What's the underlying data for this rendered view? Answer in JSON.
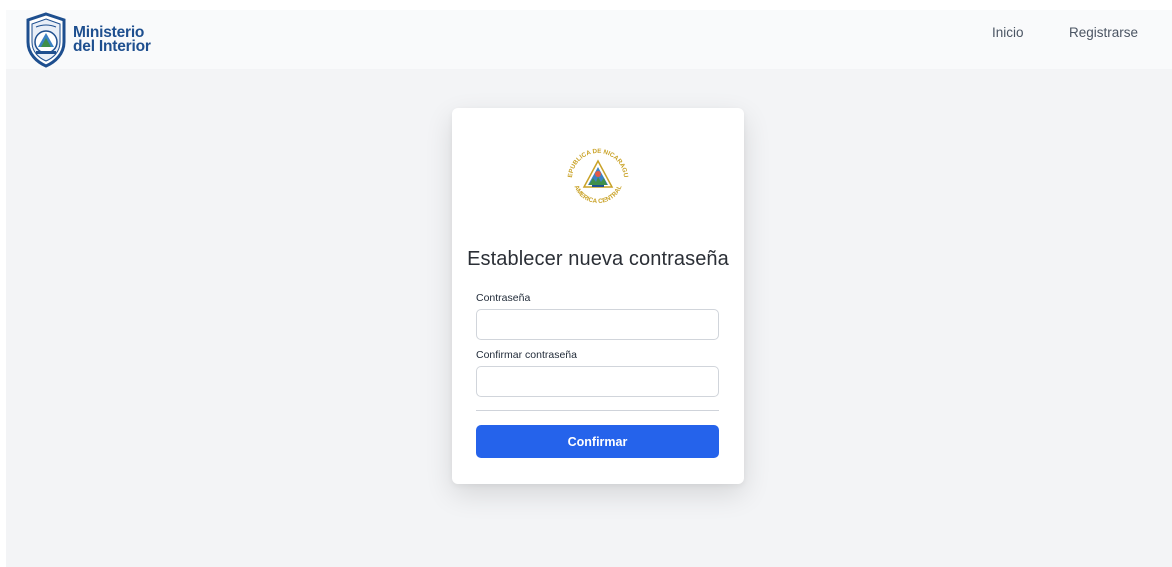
{
  "header": {
    "brand_line1": "Ministerio",
    "brand_line2": "del Interior",
    "nav": [
      {
        "label": "Inicio"
      },
      {
        "label": "Registrarse"
      }
    ]
  },
  "card": {
    "seal_top_text": "REPUBLICA DE NICARAGUA",
    "seal_bottom_text": "AMERICA CENTRAL",
    "title": "Establecer nueva contraseña",
    "fields": [
      {
        "label": "Contraseña",
        "value": "",
        "placeholder": ""
      },
      {
        "label": "Confirmar contraseña",
        "value": "",
        "placeholder": ""
      }
    ],
    "submit_label": "Confirmar"
  },
  "colors": {
    "brand": "#1e4f8f",
    "primary_button": "#2563eb",
    "background": "#f3f4f6",
    "seal_gold": "#c9a227"
  }
}
